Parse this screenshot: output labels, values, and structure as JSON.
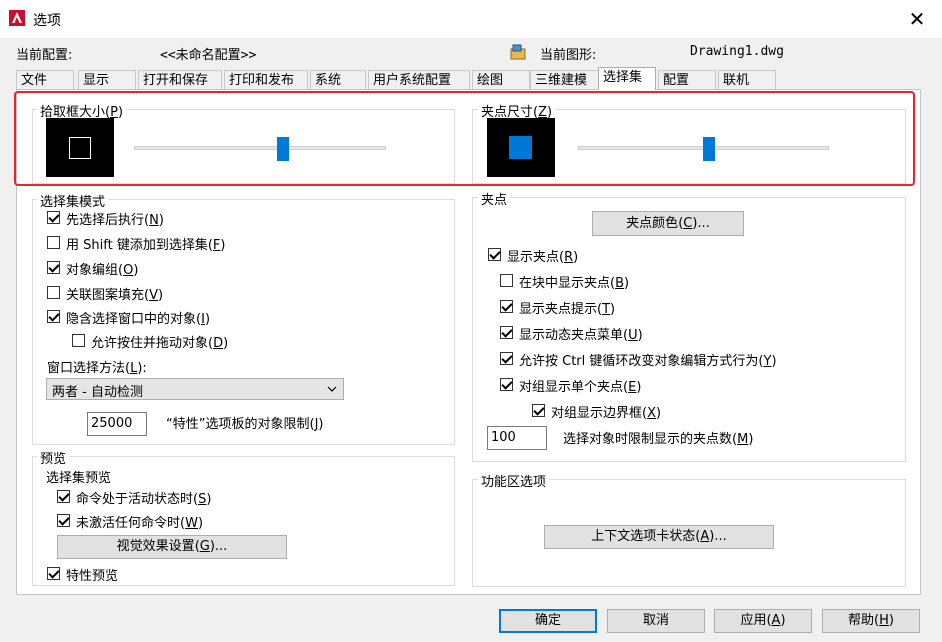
{
  "window": {
    "title": "选项",
    "close_icon": "close-icon"
  },
  "profile": {
    "current_profile_label": "当前配置:",
    "current_profile_value": "<<未命名配置>>",
    "current_drawing_label": "当前图形:",
    "current_drawing_value": "Drawing1.dwg"
  },
  "tabs": [
    {
      "label": "文件"
    },
    {
      "label": "显示"
    },
    {
      "label": "打开和保存"
    },
    {
      "label": "打印和发布"
    },
    {
      "label": "系统"
    },
    {
      "label": "用户系统配置"
    },
    {
      "label": "绘图"
    },
    {
      "label": "三维建模"
    },
    {
      "label": "选择集"
    },
    {
      "label": "配置"
    },
    {
      "label": "联机"
    }
  ],
  "active_tab": "选择集",
  "pickbox": {
    "label": "拾取框大小",
    "key": "P",
    "slider_level": 0.59
  },
  "gripsize": {
    "label": "夹点尺寸",
    "key": "Z",
    "slider_level": 0.53
  },
  "selection_modes": {
    "title": "选择集模式",
    "items": [
      {
        "label": "先选择后执行",
        "key": "N",
        "checked": true
      },
      {
        "label": "用 Shift 键添加到选择集",
        "key": "F",
        "checked": false
      },
      {
        "label": "对象编组",
        "key": "O",
        "checked": true
      },
      {
        "label": "关联图案填充",
        "key": "V",
        "checked": false
      },
      {
        "label": "隐含选择窗口中的对象",
        "key": "I",
        "checked": true
      },
      {
        "label": "允许按住并拖动对象",
        "key": "D",
        "checked": false
      }
    ],
    "window_method_label": "窗口选择方法",
    "window_method_key": "L",
    "window_method_value": "两者 - 自动检测",
    "object_limit_value": "25000",
    "object_limit_label": "“特性”选项板的对象限制",
    "object_limit_key": "J"
  },
  "grips": {
    "title": "夹点",
    "grip_color_button": "夹点颜色",
    "grip_color_key": "C",
    "items": [
      {
        "label": "显示夹点",
        "key": "R",
        "checked": true
      },
      {
        "label": "在块中显示夹点",
        "key": "B",
        "checked": false
      },
      {
        "label": "显示夹点提示",
        "key": "T",
        "checked": true
      },
      {
        "label": "显示动态夹点菜单",
        "key": "U",
        "checked": true
      },
      {
        "label": "允许按 Ctrl 键循环改变对象编辑方式行为",
        "key": "Y",
        "checked": true
      },
      {
        "label": "对组显示单个夹点",
        "key": "E",
        "checked": true
      },
      {
        "label": "对组显示边界框",
        "key": "X",
        "checked": true
      }
    ],
    "grip_limit_value": "100",
    "grip_limit_label": "选择对象时限制显示的夹点数",
    "grip_limit_key": "M"
  },
  "preview": {
    "title": "预览",
    "subtitle": "选择集预览",
    "items": [
      {
        "label": "命令处于活动状态时",
        "key": "S",
        "checked": true
      },
      {
        "label": "未激活任何命令时",
        "key": "W",
        "checked": true
      }
    ],
    "visual_effects_button": "视觉效果设置",
    "visual_effects_key": "G",
    "property_preview": {
      "label": "特性预览",
      "checked": true
    }
  },
  "ribbon": {
    "title": "功能区选项",
    "context_button": "上下文选项卡状态",
    "context_key": "A"
  },
  "footer": {
    "ok": "确定",
    "cancel": "取消",
    "apply": "应用",
    "apply_key": "A",
    "help": "帮助",
    "help_key": "H"
  },
  "colors": {
    "accent": "#0078d7",
    "highlight": "#e8262a"
  }
}
